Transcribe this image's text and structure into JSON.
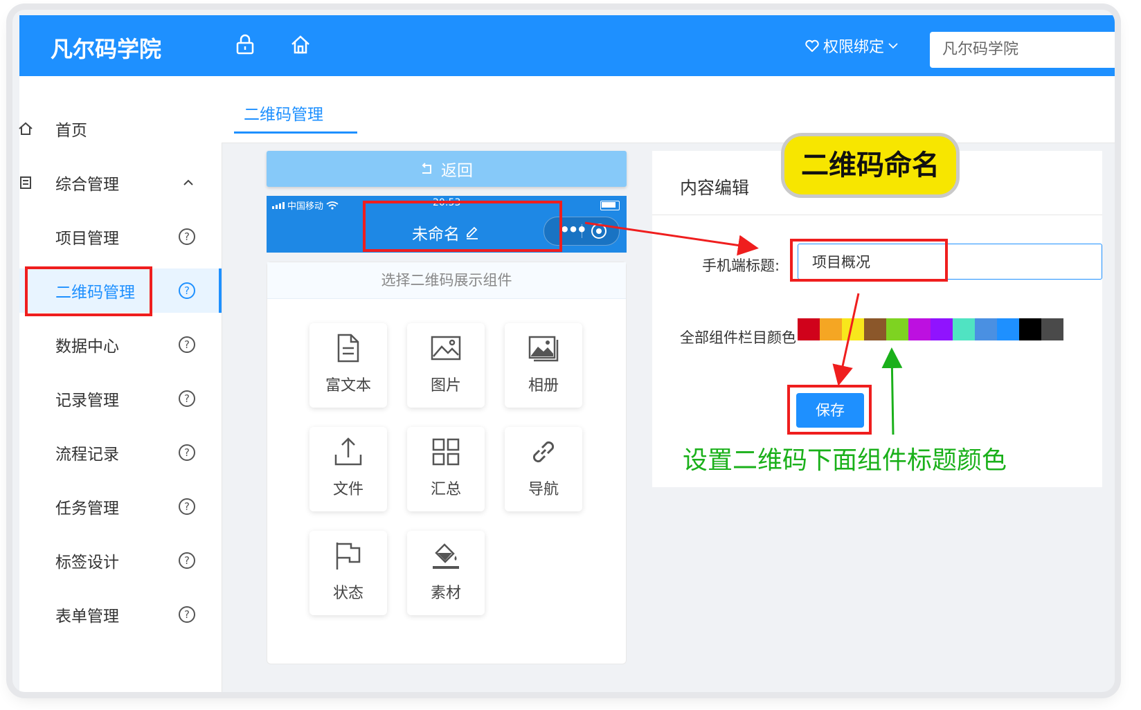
{
  "header": {
    "logo": "凡尔码学院",
    "lock_icon": "lock-icon",
    "home_icon": "home-icon",
    "permission_label": "权限绑定",
    "search_value": "凡尔码学院"
  },
  "sidebar": {
    "items": [
      {
        "label": "首页",
        "icon": "home-icon"
      },
      {
        "label": "综合管理",
        "icon": "menu-icon"
      },
      {
        "label": "项目管理",
        "help": "?"
      },
      {
        "label": "二维码管理",
        "help": "?"
      },
      {
        "label": "数据中心",
        "help": "?"
      },
      {
        "label": "记录管理",
        "help": "?"
      },
      {
        "label": "流程记录",
        "help": "?"
      },
      {
        "label": "任务管理",
        "help": "?"
      },
      {
        "label": "标签设计",
        "help": "?"
      },
      {
        "label": "表单管理",
        "help": "?"
      }
    ]
  },
  "tabs": {
    "active": "二维码管理"
  },
  "phone": {
    "back_label": "返回",
    "carrier": "中国移动",
    "time": "20:53",
    "title": "未命名",
    "components_header": "选择二维码展示组件",
    "components": [
      {
        "label": "富文本",
        "icon": "document-icon"
      },
      {
        "label": "图片",
        "icon": "image-icon"
      },
      {
        "label": "相册",
        "icon": "album-icon"
      },
      {
        "label": "文件",
        "icon": "upload-icon"
      },
      {
        "label": "汇总",
        "icon": "grid-icon"
      },
      {
        "label": "导航",
        "icon": "link-icon"
      },
      {
        "label": "状态",
        "icon": "flag-icon"
      },
      {
        "label": "素材",
        "icon": "paint-bucket-icon"
      }
    ]
  },
  "editor": {
    "title": "内容编辑",
    "mobile_title_label": "手机端标题:",
    "mobile_title_value": "项目概况",
    "color_label": "全部组件栏目颜色",
    "swatches": [
      "#d0021b",
      "#f5a623",
      "#f8e71c",
      "#8b572a",
      "#7ed321",
      "#bd10e0",
      "#9013fe",
      "#50e3c2",
      "#4a90e2",
      "#1e90ff",
      "#000000",
      "#4a4a4a"
    ],
    "save_label": "保存"
  },
  "annotations": {
    "badge": "二维码命名",
    "green_note": "设置二维码下面组件标题颜色",
    "red": "#ef1e1e",
    "green": "#1ab01a",
    "yellow": "#f7e600"
  }
}
